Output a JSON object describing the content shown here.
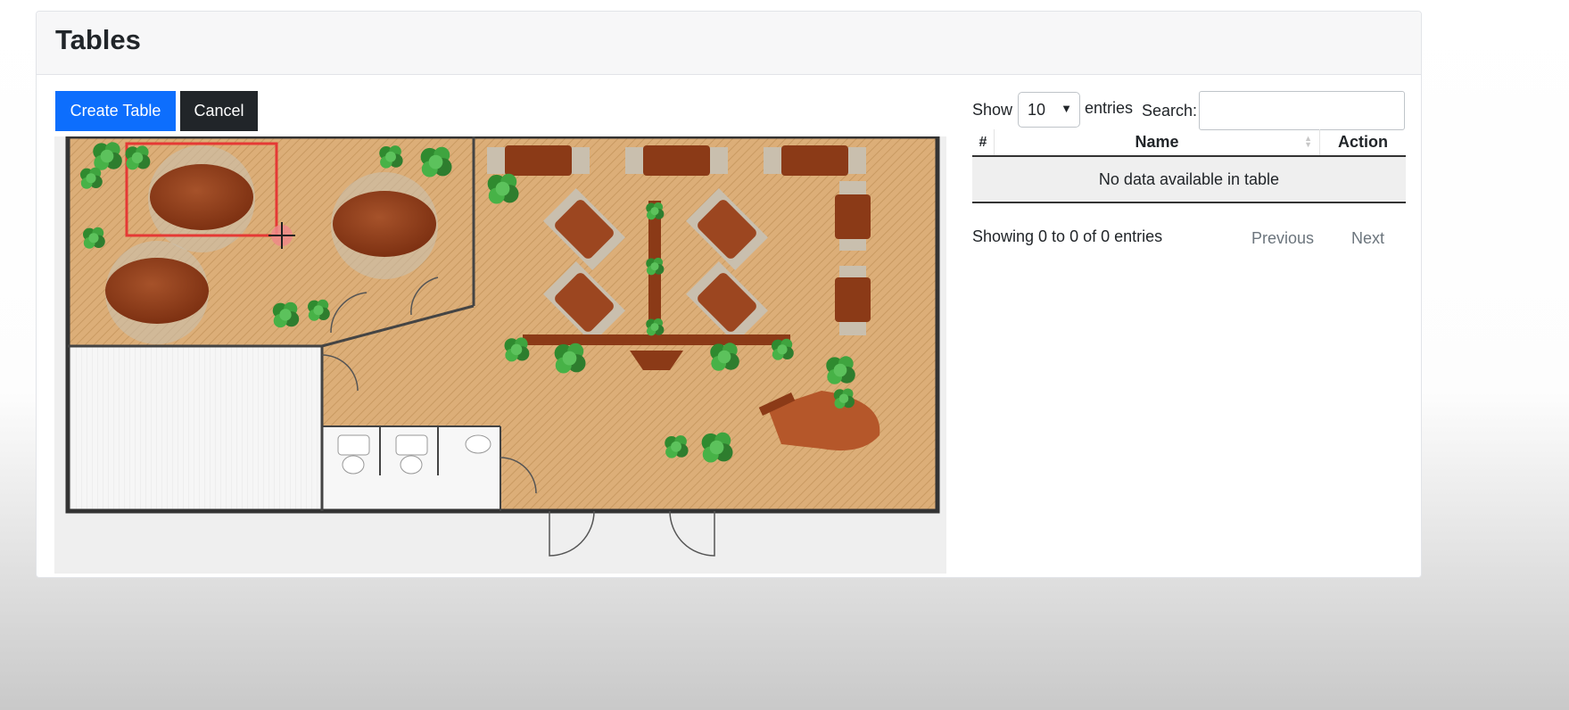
{
  "page": {
    "title": "Tables"
  },
  "toolbar": {
    "create_label": "Create Table",
    "cancel_label": "Cancel"
  },
  "colors": {
    "primary": "#0d6efd",
    "dark": "#212529",
    "selection": "#e53935",
    "floor": "#dfb07a",
    "table_wood": "#8b3a17",
    "plant": "#3a9a3a"
  },
  "floor_plan": {
    "image": "restaurant-floor-plan",
    "selection_icon": "move-crosshair-icon"
  },
  "datatable": {
    "show_label": "Show",
    "page_length": "10",
    "entries_label": "entries",
    "search_label": "Search:",
    "search_value": "",
    "columns": [
      "#",
      "Name",
      "Action"
    ],
    "empty_message": "No data available in table",
    "info": "Showing 0 to 0 of 0 entries",
    "prev_label": "Previous",
    "next_label": "Next"
  }
}
